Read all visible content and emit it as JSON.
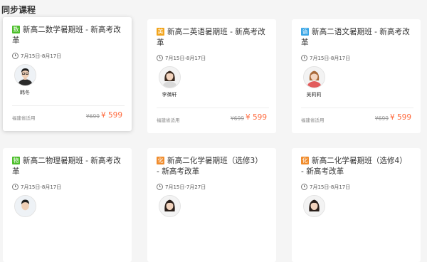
{
  "section": {
    "title": "同步课程"
  },
  "colors": {
    "price": "#ff6a3d",
    "math": "#4cbe2a",
    "english": "#f2a41b",
    "chinese": "#3aa6e6",
    "physics": "#4cbe2a",
    "chemistry": "#f08c2d"
  },
  "courses": [
    {
      "badge": "数",
      "title": "新高二数学暑期班 - 新高考改革",
      "date": "7月15日-8月17日",
      "teacher": "韩冬",
      "region": "福建省适用",
      "old_price": "¥699",
      "price": "¥ 599",
      "avatar_icon": "teacher-avatar-male"
    },
    {
      "badge": "英",
      "title": "新高二英语暑期班 - 新高考改革",
      "date": "7月15日-8月17日",
      "teacher": "李蒨轩",
      "region": "福建省适用",
      "old_price": "¥699",
      "price": "¥ 599",
      "avatar_icon": "teacher-avatar-female"
    },
    {
      "badge": "语",
      "title": "新高二语文暑期班 - 新高考改革",
      "date": "7月15日-8月17日",
      "teacher": "吴莉莉",
      "region": "福建省适用",
      "old_price": "¥699",
      "price": "¥ 599",
      "avatar_icon": "teacher-avatar-female"
    },
    {
      "badge": "物",
      "title": "新高二物理暑期班 - 新高考改革",
      "date": "7月15日-8月17日",
      "teacher": "",
      "region": "",
      "old_price": "",
      "price": "",
      "avatar_icon": "teacher-avatar-male"
    },
    {
      "badge": "化",
      "title": "新高二化学暑期班（选修3） - 新高考改革",
      "date": "7月15日-7月27日",
      "teacher": "",
      "region": "",
      "old_price": "",
      "price": "",
      "avatar_icon": "teacher-avatar-female"
    },
    {
      "badge": "化",
      "title": "新高二化学暑期班（选修4） - 新高考改革",
      "date": "7月15日-8月17日",
      "teacher": "",
      "region": "",
      "old_price": "",
      "price": "",
      "avatar_icon": "teacher-avatar-female"
    }
  ]
}
